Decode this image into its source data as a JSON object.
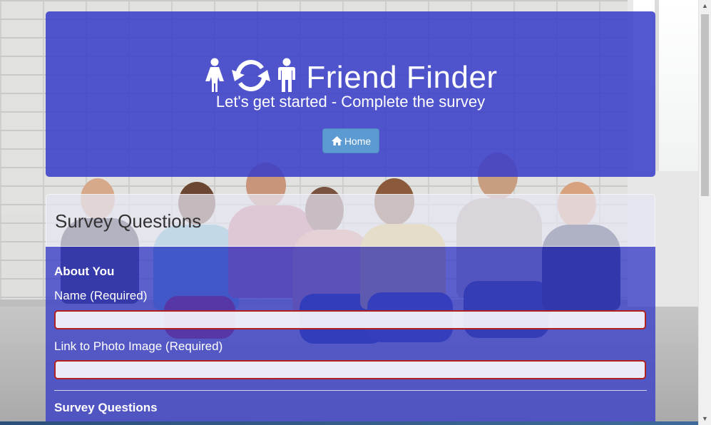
{
  "header": {
    "icons": [
      "female-icon",
      "refresh-icon",
      "male-icon"
    ],
    "title": "Friend Finder",
    "subtitle": "Let's get started - Complete the survey",
    "home_button_label": "Home",
    "home_icon": "home-icon"
  },
  "survey": {
    "panel_title": "Survey Questions",
    "about_section_title": "About You",
    "name_label": "Name (Required)",
    "name_value": "",
    "photo_label": "Link to Photo Image (Required)",
    "photo_value": "",
    "questions_section_title": "Survey Questions"
  },
  "colors": {
    "panel_blue": "#373cc8",
    "home_button": "#5b9bd1",
    "input_error_border": "#b32020"
  }
}
